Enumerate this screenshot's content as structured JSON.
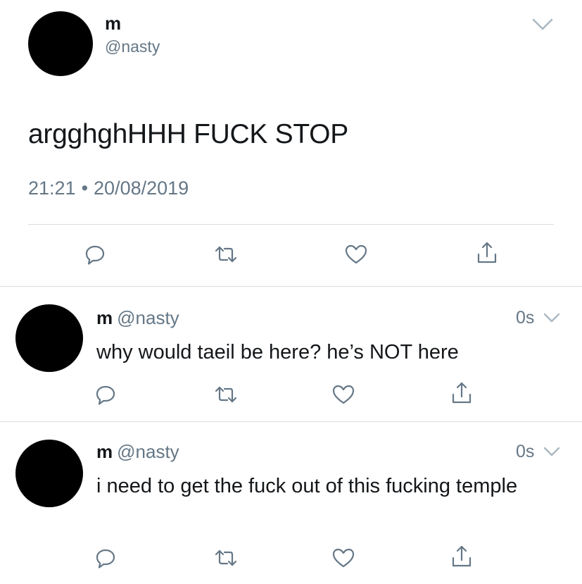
{
  "main_tweet": {
    "name": "m",
    "handle": "@nasty",
    "text": "argghghHHH FUCK STOP",
    "time": "21:21",
    "separator": "•",
    "date": "20/08/2019",
    "icons": [
      "reply-icon",
      "retweet-icon",
      "like-icon",
      "share-icon",
      "chevron-down-icon"
    ]
  },
  "replies": [
    {
      "name": "m",
      "handle": "@nasty",
      "time": "0s",
      "text": "why would taeil be here? he’s NOT here"
    },
    {
      "name": "m",
      "handle": "@nasty",
      "time": "0s",
      "text": "i need to get the fuck out of this fucking temple"
    }
  ],
  "colors": {
    "text": "#14171a",
    "secondary": "#657786",
    "divider": "#d7dde2",
    "avatar": "#000000",
    "background": "#ffffff"
  }
}
